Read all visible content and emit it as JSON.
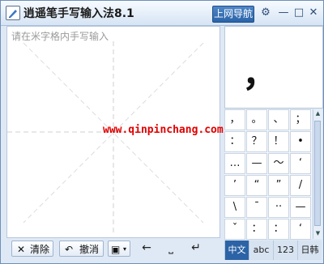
{
  "app": {
    "title": "逍遥笔手写输入法8.1",
    "nav_button": "上网导航",
    "settings_icon": "gear-icon",
    "minimize_glyph": "—",
    "maximize_glyph": "□",
    "close_glyph": "✕"
  },
  "writing_area": {
    "hint": "请在米字格内手写输入",
    "watermark": "www.qinpinchang.com"
  },
  "preview": {
    "char": "，"
  },
  "symbols": [
    "，",
    "。",
    "、",
    "；",
    "：",
    "？",
    "！",
    "•",
    "…",
    "—",
    "～",
    "‘",
    "’",
    "“",
    "”",
    "/",
    "\\",
    "¯",
    "··",
    "—",
    "ˇ",
    "：",
    "：",
    "‘"
  ],
  "bottom": {
    "clear_label": "清除",
    "undo_label": "撤消",
    "left_arrow": "←",
    "space_glyph": "⎵",
    "enter_glyph": "↵"
  },
  "tabs": [
    "中文",
    "abc",
    "123",
    "日韩"
  ],
  "colors": {
    "accent": "#2c63a6",
    "watermark": "#e00000"
  }
}
